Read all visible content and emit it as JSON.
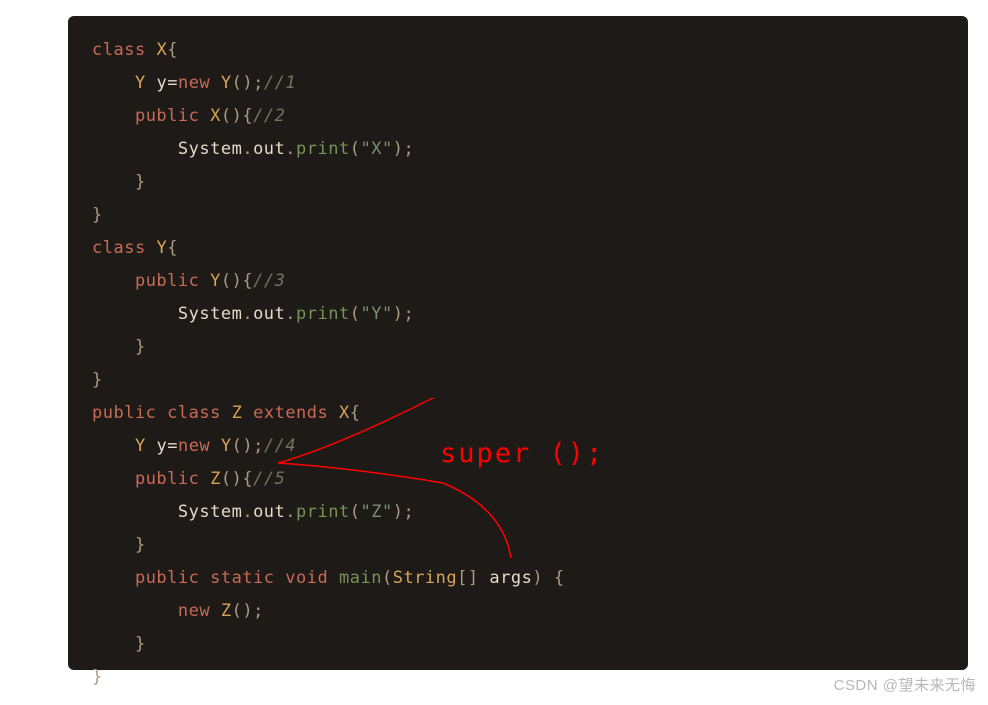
{
  "code": {
    "line1": {
      "kw1": "class",
      "cls": "X",
      "punct": "{"
    },
    "line2": {
      "indent": "    ",
      "type": "Y",
      "var": "y",
      "op": "=",
      "kw": "new",
      "call": "Y",
      "parens": "()",
      "semi": ";",
      "comment": "//1"
    },
    "line3": {
      "indent": "    ",
      "kw": "public",
      "ctor": "X",
      "parens": "()",
      "brace": "{",
      "comment": "//2"
    },
    "line4": {
      "indent": "        ",
      "obj1": "System",
      "dot1": ".",
      "obj2": "out",
      "dot2": ".",
      "method": "print",
      "open": "(",
      "str": "\"X\"",
      "close": ")",
      "semi": ";"
    },
    "line5": {
      "indent": "    ",
      "brace": "}"
    },
    "line6": {
      "brace": "}"
    },
    "line7": {
      "kw1": "class",
      "cls": "Y",
      "punct": "{"
    },
    "line8": {
      "indent": "    ",
      "kw": "public",
      "ctor": "Y",
      "parens": "()",
      "brace": "{",
      "comment": "//3"
    },
    "line9": {
      "indent": "        ",
      "obj1": "System",
      "dot1": ".",
      "obj2": "out",
      "dot2": ".",
      "method": "print",
      "open": "(",
      "str": "\"Y\"",
      "close": ")",
      "semi": ";"
    },
    "line10": {
      "indent": "    ",
      "brace": "}"
    },
    "line11": {
      "brace": "}"
    },
    "line12": {
      "kw1": "public",
      "kw2": "class",
      "cls": "Z",
      "kw3": "extends",
      "parent": "X",
      "punct": "{"
    },
    "line13": {
      "indent": "    ",
      "type": "Y",
      "var": "y",
      "op": "=",
      "kw": "new",
      "call": "Y",
      "parens": "()",
      "semi": ";",
      "comment": "//4"
    },
    "line14": {
      "indent": "    ",
      "kw": "public",
      "ctor": "Z",
      "parens": "()",
      "brace": "{",
      "comment": "//5"
    },
    "line15": {
      "indent": "        ",
      "obj1": "System",
      "dot1": ".",
      "obj2": "out",
      "dot2": ".",
      "method": "print",
      "open": "(",
      "str": "\"Z\"",
      "close": ")",
      "semi": ";"
    },
    "line16": {
      "indent": "    ",
      "brace": "}"
    },
    "line17": {
      "indent": "    ",
      "kw1": "public",
      "kw2": "static",
      "kw3": "void",
      "method": "main",
      "open": "(",
      "type": "String",
      "arr": "[]",
      "param": "args",
      "close": ")",
      "brace": "{"
    },
    "line18": {
      "indent": "        ",
      "kw": "new",
      "call": "Z",
      "parens": "()",
      "semi": ";"
    },
    "line19": {
      "indent": "    ",
      "brace": "}"
    },
    "line20": {
      "brace": "}"
    }
  },
  "annotation": "super ();",
  "watermark": "CSDN @望未来无悔"
}
